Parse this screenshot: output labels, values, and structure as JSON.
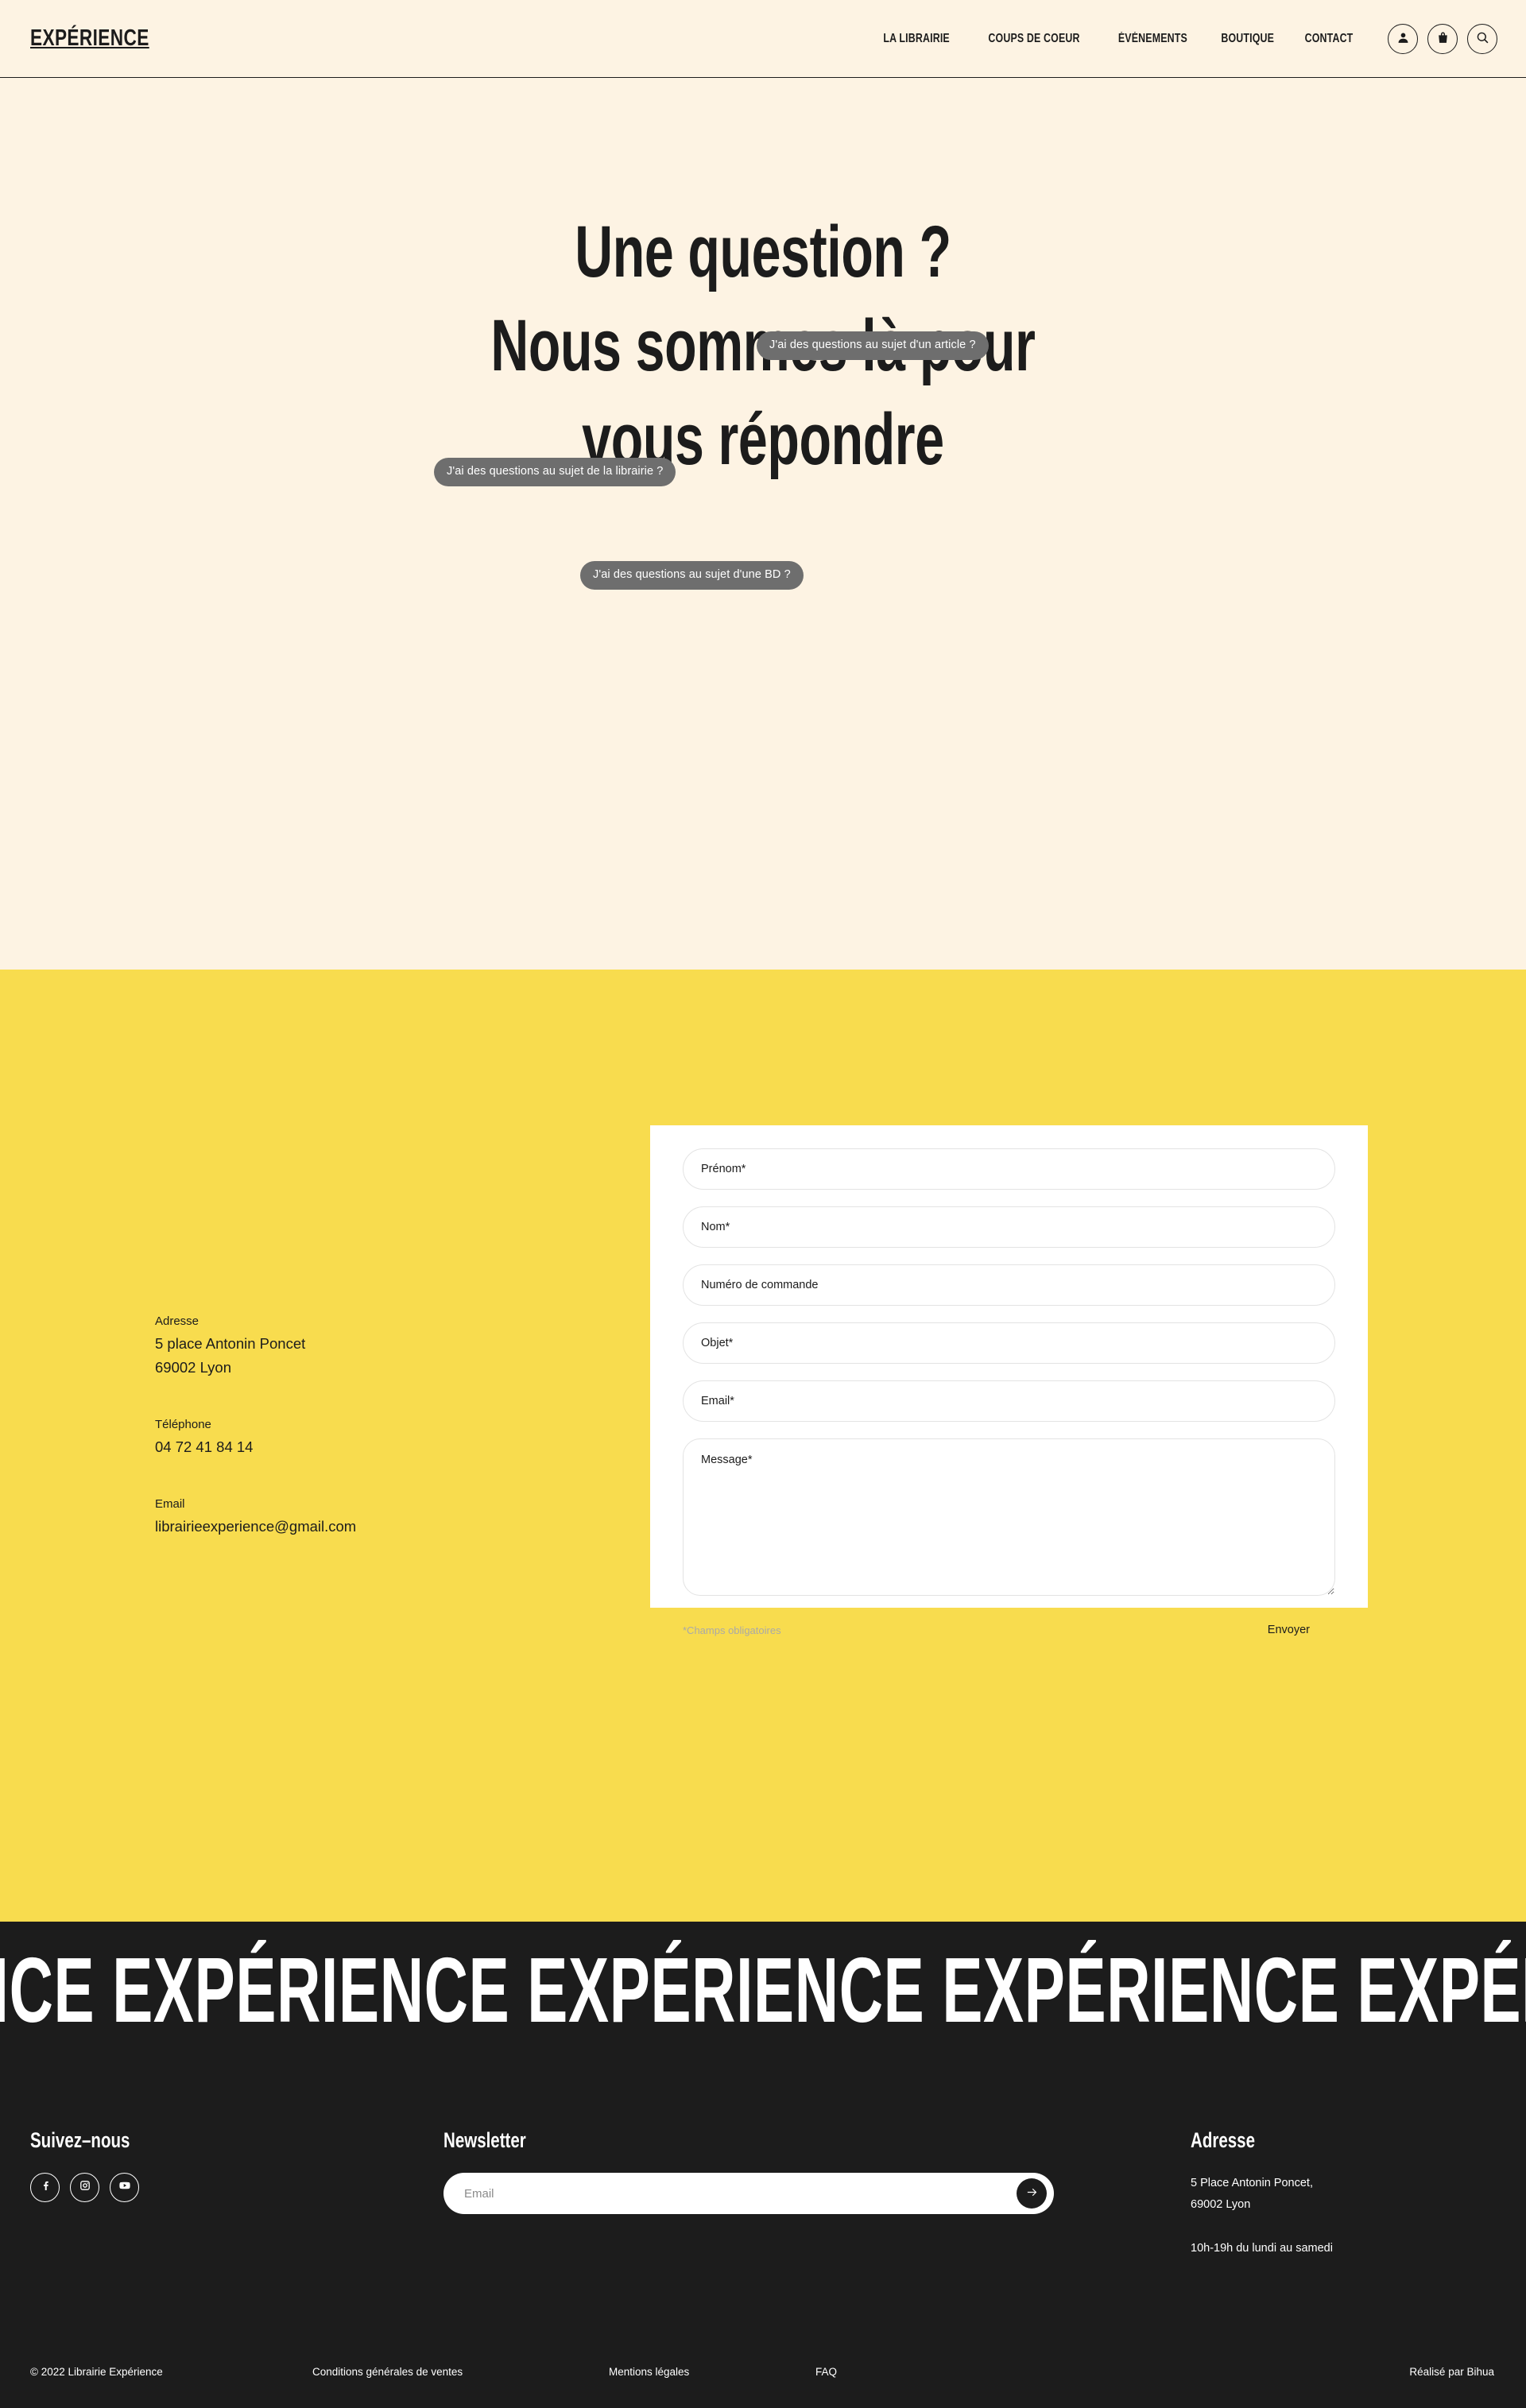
{
  "colors": {
    "cream": "#FDF3E3",
    "yellow": "#F8DC4E",
    "dark": "#1C1C1C",
    "tooltip_gray": "#6E6E6E",
    "white": "#FFFFFF"
  },
  "header": {
    "logo": "EXPÉRIENCE",
    "nav": [
      {
        "label": "LA LIBRAIRIE"
      },
      {
        "label": "COUPS DE COEUR"
      },
      {
        "label": "ÉVÉNEMENTS"
      },
      {
        "label": "BOUTIQUE"
      },
      {
        "label": "CONTACT"
      }
    ],
    "icons": [
      {
        "name": "account-icon"
      },
      {
        "name": "shopping-bag-icon"
      },
      {
        "name": "search-icon"
      }
    ]
  },
  "hero": {
    "title": "Une question ?\nNous sommes là pour\nvous répondre",
    "tooltips": [
      {
        "text": "J'ai des questions au sujet d'un article ?"
      },
      {
        "text": "J'ai des questions au sujet de la librairie ?"
      },
      {
        "text": "J'ai des questions au sujet d'une BD ?"
      }
    ]
  },
  "contact": {
    "info": [
      {
        "label": "Adresse",
        "lines": [
          "5 place Antonin Poncet",
          "69002 Lyon"
        ]
      },
      {
        "label": "Téléphone",
        "lines": [
          "04 72 41 84 14"
        ]
      },
      {
        "label": "Email",
        "lines": [
          "librairieexperience@gmail.com"
        ]
      }
    ],
    "form": {
      "fields": [
        {
          "name": "prenom",
          "placeholder": "Prénom*",
          "value": ""
        },
        {
          "name": "nom",
          "placeholder": "Nom*",
          "value": ""
        },
        {
          "name": "numero-de-commande",
          "placeholder": "Numéro de commande",
          "value": ""
        },
        {
          "name": "objet",
          "placeholder": "Objet*",
          "value": ""
        },
        {
          "name": "email",
          "placeholder": "Email*",
          "value": ""
        }
      ],
      "message": {
        "placeholder": "Message*",
        "value": ""
      },
      "required_note": "*Champs obligatoires",
      "submit_label": "Envoyer"
    }
  },
  "marquee": {
    "text": "IENCE EXPÉRIENCE EXPÉRIENCE EXPÉRIENCE EXPÉRIEN"
  },
  "footer": {
    "follow": {
      "title": "Suivez–nous",
      "socials": [
        {
          "name": "facebook-icon"
        },
        {
          "name": "instagram-icon"
        },
        {
          "name": "youtube-icon"
        }
      ]
    },
    "newsletter": {
      "title": "Newsletter",
      "placeholder": "Email",
      "value": "",
      "submit_icon": "arrow-right-icon"
    },
    "address": {
      "title": "Adresse",
      "line1": "5 Place Antonin Poncet,",
      "line2": "69002 Lyon",
      "hours": "10h-19h du lundi au samedi"
    },
    "bar": {
      "copyright": "© 2022 Librairie Expérience",
      "link1": "Conditions générales de ventes",
      "link2": "Mentions légales",
      "link3": "FAQ",
      "credit": "Réalisé par Bihua"
    }
  }
}
